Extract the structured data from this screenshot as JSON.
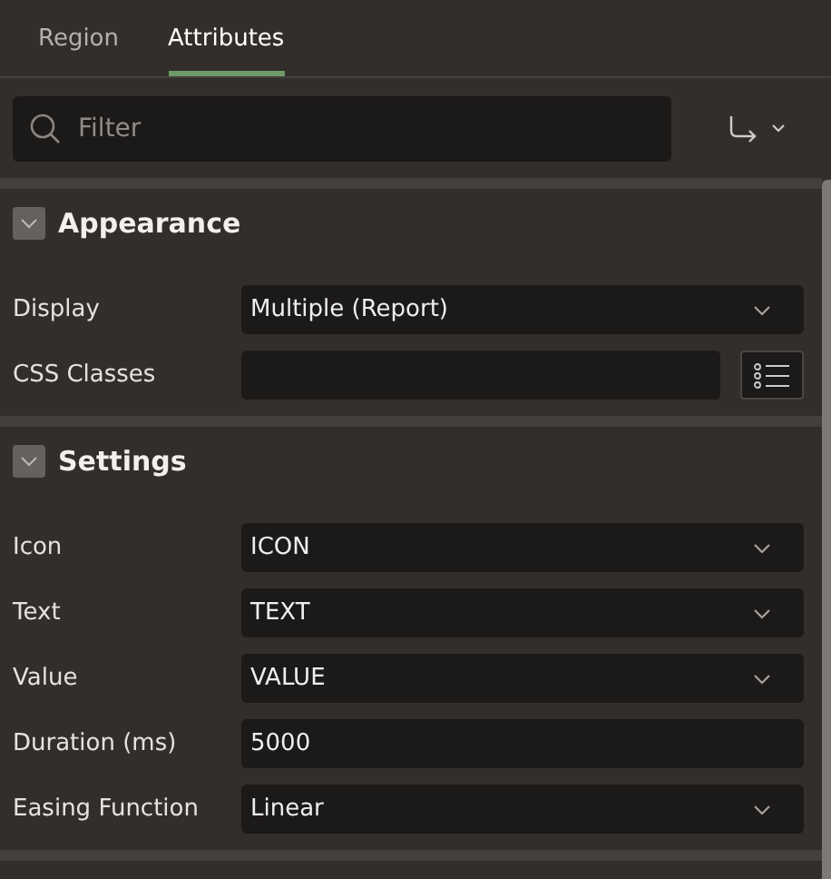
{
  "tabs": [
    {
      "label": "Region",
      "selected": false
    },
    {
      "label": "Attributes",
      "selected": true
    }
  ],
  "filter": {
    "placeholder": "Filter"
  },
  "sections": [
    {
      "title": "Appearance",
      "expanded": true,
      "fields": [
        {
          "label": "Display",
          "kind": "select",
          "value": "Multiple (Report)"
        },
        {
          "label": "CSS Classes",
          "kind": "picker"
        }
      ]
    },
    {
      "title": "Settings",
      "expanded": true,
      "fields": [
        {
          "label": "Icon",
          "kind": "select",
          "value": "ICON"
        },
        {
          "label": "Text",
          "kind": "select",
          "value": "TEXT"
        },
        {
          "label": "Value",
          "kind": "select",
          "value": "VALUE"
        },
        {
          "label": "Duration (ms)",
          "kind": "text",
          "value": "5000"
        },
        {
          "label": "Easing Function",
          "kind": "select",
          "value": "Linear"
        }
      ]
    }
  ]
}
